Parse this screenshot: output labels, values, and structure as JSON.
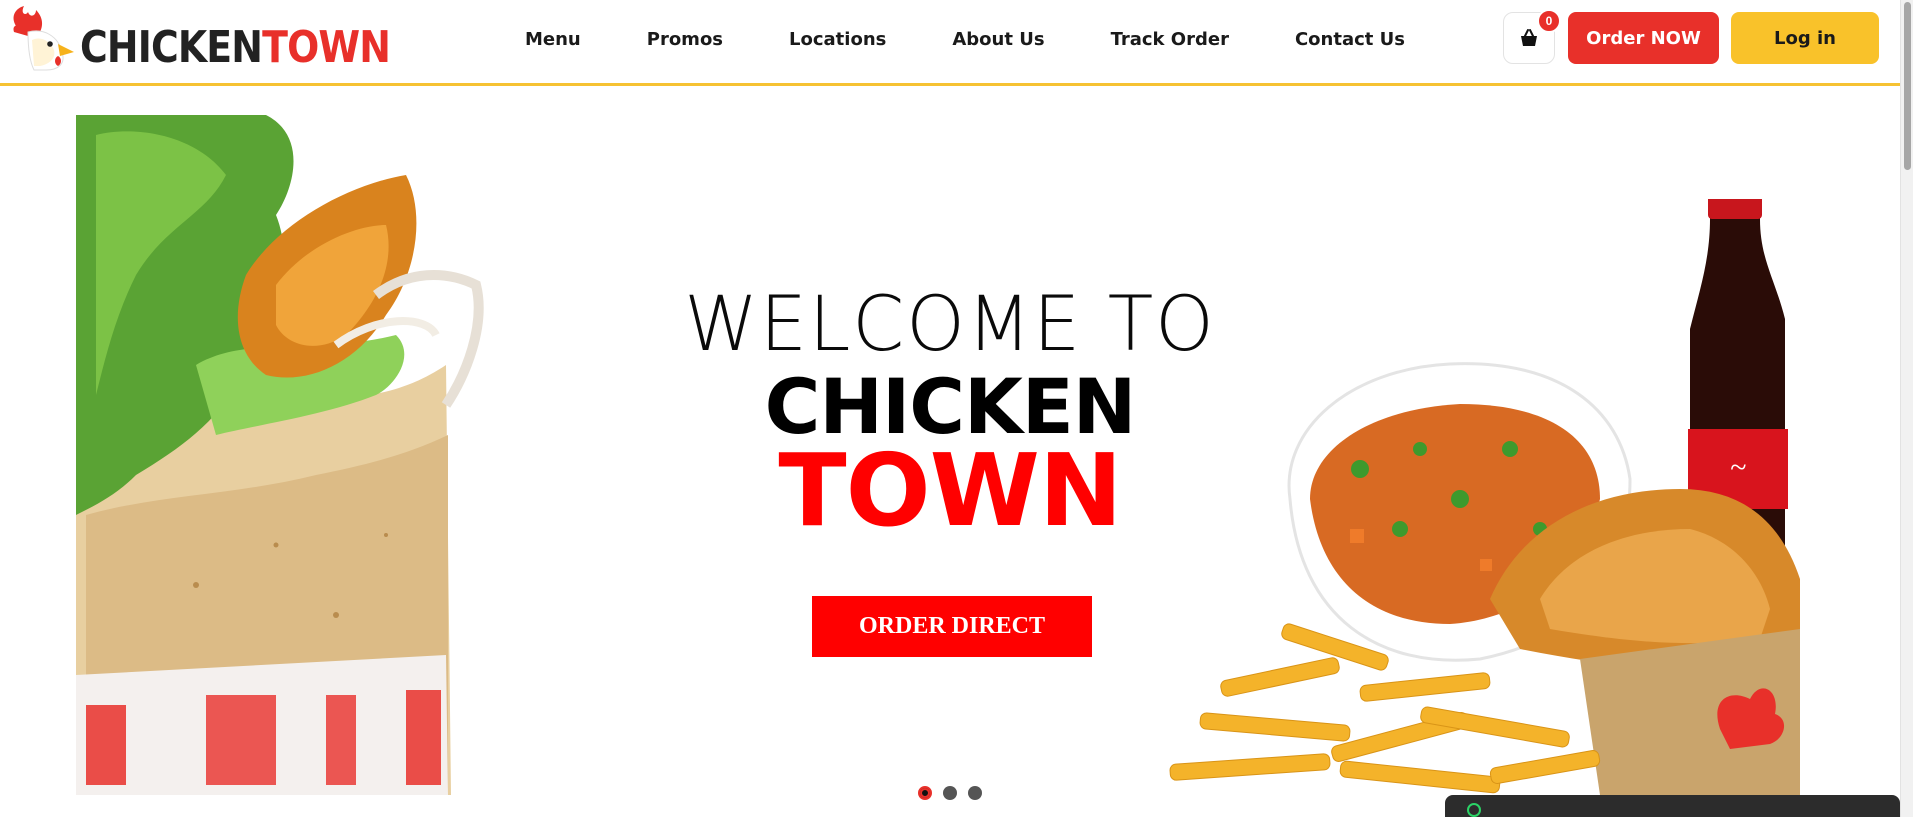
{
  "brand": {
    "name_part1": "CHICKEN",
    "name_part2": "TOWN",
    "dark_color": "#222222",
    "accent_color": "#e8302a"
  },
  "nav": {
    "items": [
      {
        "label": "Menu"
      },
      {
        "label": "Promos"
      },
      {
        "label": "Locations"
      },
      {
        "label": "About Us"
      },
      {
        "label": "Track Order"
      },
      {
        "label": "Contact Us"
      }
    ]
  },
  "header": {
    "cart_count": "0",
    "order_button": "Order NOW",
    "login_button": "Log in",
    "order_color": "#e8302a",
    "login_color": "#f9c22a",
    "border_color": "#f6c232"
  },
  "hero": {
    "welcome": "WELCOME TO",
    "brand_line1": "CHICKEN",
    "brand_line2": "TOWN",
    "cta_label": "ORDER DIRECT",
    "cta_color": "#ff0000",
    "slides_total": 3,
    "active_slide": 1
  }
}
